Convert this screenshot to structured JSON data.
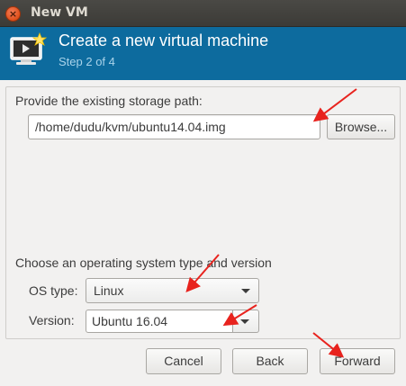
{
  "window": {
    "title": "New VM",
    "close_glyph": "×"
  },
  "header": {
    "title": "Create a new virtual machine",
    "step": "Step 2 of 4",
    "icon": "new-vm-monitor-icon",
    "accent_color": "#0d6b9e"
  },
  "storage": {
    "label": "Provide the existing storage path:",
    "path_value": "/home/dudu/kvm/ubuntu14.04.img",
    "browse_label": "Browse..."
  },
  "os": {
    "section_label": "Choose an operating system type and version",
    "type_label": "OS type:",
    "type_value": "Linux",
    "version_label": "Version:",
    "version_value": "Ubuntu 16.04"
  },
  "buttons": {
    "cancel": "Cancel",
    "back": "Back",
    "forward": "Forward"
  },
  "annotations": {
    "arrow_color": "#e8231e",
    "arrow_icon": "red-arrow-icon"
  }
}
